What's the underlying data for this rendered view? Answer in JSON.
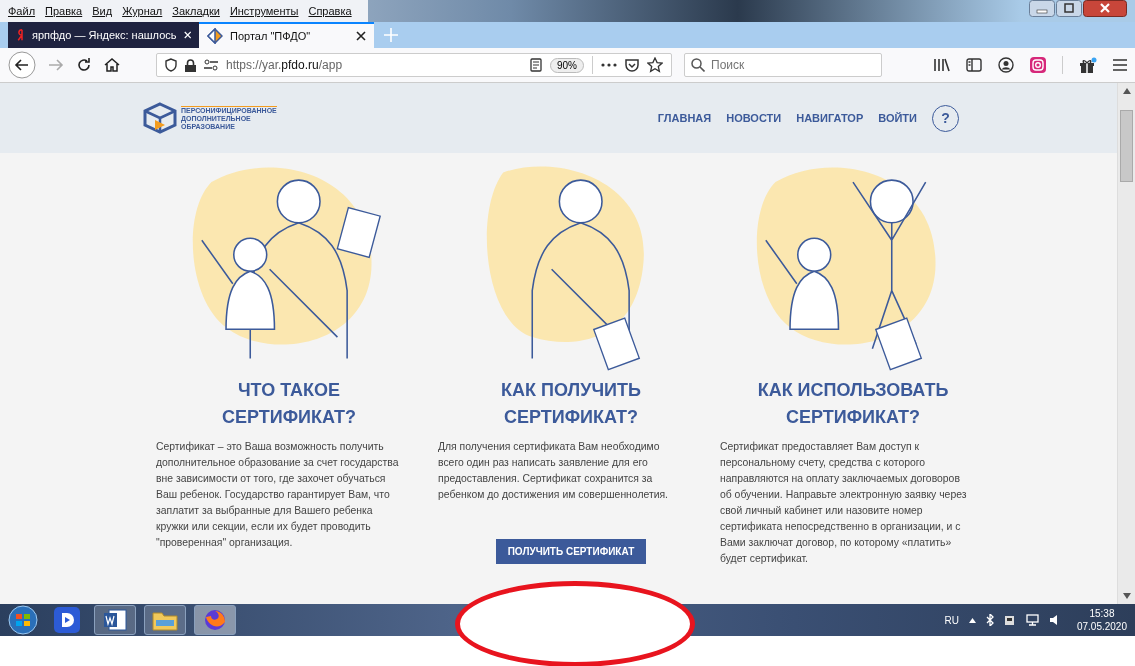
{
  "menu": [
    "Файл",
    "Правка",
    "Вид",
    "Журнал",
    "Закладки",
    "Инструменты",
    "Справка"
  ],
  "tabs": [
    {
      "title": "ярпфдо — Яндекс: нашлось",
      "selected": false
    },
    {
      "title": "Портал \"ПФДО\"",
      "selected": true
    }
  ],
  "address_bar": {
    "url_scheme": "https://yar.",
    "url_host": "pfdo.ru",
    "url_path": "/app",
    "zoom": "90%"
  },
  "search": {
    "placeholder": "Поиск"
  },
  "site": {
    "logo_lines": [
      "ПЕРСОНИФИЦИРОВАННОЕ",
      "ДОПОЛНИТЕЛЬНОЕ",
      "ОБРАЗОВАНИЕ"
    ],
    "nav": [
      "ГЛАВНАЯ",
      "НОВОСТИ",
      "НАВИГАТОР",
      "ВОЙТИ"
    ],
    "help": "?"
  },
  "columns": [
    {
      "title_lines": [
        "ЧТО ТАКОЕ",
        "СЕРТИФИКАТ?"
      ],
      "text": "Сертификат – это Ваша возможность получить дополнительное образование за счет государства вне зависимости от того, где захочет обучаться Ваш ребенок. Государство гарантирует Вам, что заплатит за выбранные для Вашего ребенка кружки или секции, если их будет проводить \"проверенная\" организация."
    },
    {
      "title_lines": [
        "КАК ПОЛУЧИТЬ",
        "СЕРТИФИКАТ?"
      ],
      "text": "Для получения сертификата Вам необходимо всего один раз написать заявление для его предоставления. Сертификат сохранится за ребенком до достижения им совершеннолетия.",
      "button": "ПОЛУЧИТЬ СЕРТИФИКАТ"
    },
    {
      "title_lines": [
        "КАК ИСПОЛЬЗОВАТЬ",
        "СЕРТИФИКАТ?"
      ],
      "text": "Сертификат предоставляет Вам доступ к персональному счету, средства с которого направляются на оплату заключаемых договоров об обучении. Направьте электронную заявку через свой личный кабинет или назовите номер сертификата непосредственно в организации, и с Вами заключат договор, по которому «платить» будет сертификат."
    }
  ],
  "taskbar": {
    "language": "RU",
    "time": "15:38",
    "date": "07.05.2020"
  }
}
